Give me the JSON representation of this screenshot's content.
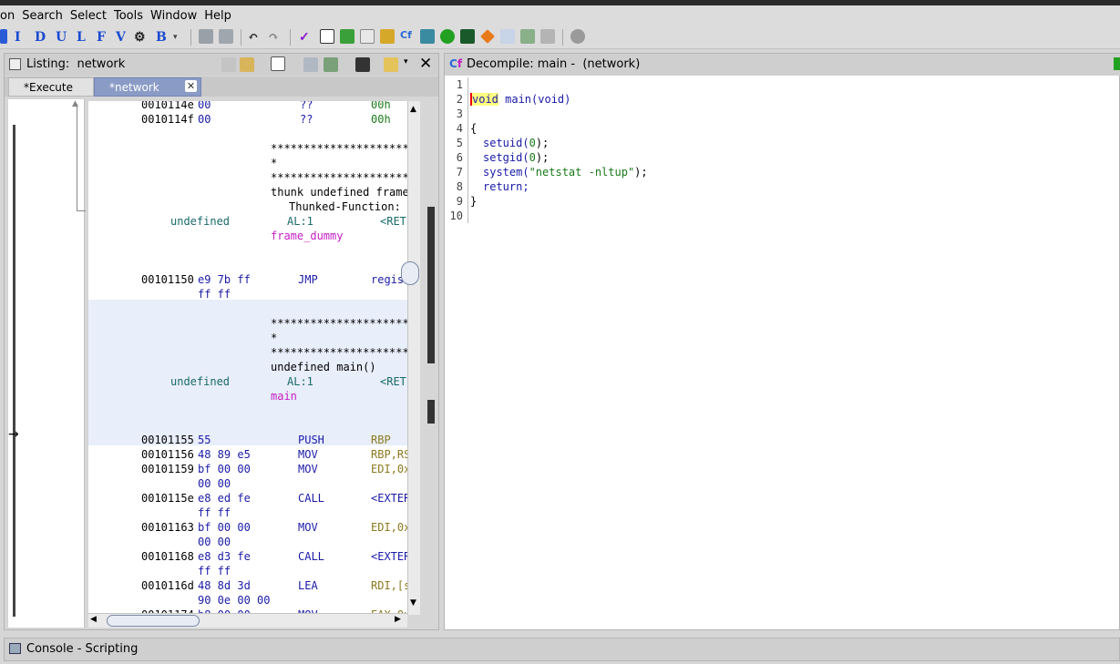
{
  "menu": [
    "on",
    "Search",
    "Select",
    "Tools",
    "Window",
    "Help"
  ],
  "toolbar": {
    "letters": [
      "I",
      "D",
      "U",
      "L",
      "F",
      "V",
      "B"
    ]
  },
  "listing": {
    "title": "Listing:  network",
    "tabs": [
      {
        "label": "*Execute"
      },
      {
        "label": "*network"
      }
    ],
    "rows": [
      {
        "addr": "0010114e",
        "bytes": "00",
        "mn": "??",
        "op": "00h"
      },
      {
        "addr": "0010114f",
        "bytes": "00",
        "mn": "??",
        "op": "00h"
      },
      {
        "addr": "00101150",
        "bytes": "e9 7b ff",
        "bytes2": "ff ff",
        "mn": "JMP",
        "op": "regist"
      },
      {
        "addr": "00101155",
        "bytes": "55",
        "mn": "PUSH",
        "op": "RBP"
      },
      {
        "addr": "00101156",
        "bytes": "48 89 e5",
        "mn": "MOV",
        "op": "RBP,RS"
      },
      {
        "addr": "00101159",
        "bytes": "bf 00 00",
        "bytes2": "00 00",
        "mn": "MOV",
        "op": "EDI,0x"
      },
      {
        "addr": "0010115e",
        "bytes": "e8 ed fe",
        "bytes2": "ff ff",
        "mn": "CALL",
        "op": "<EXTER"
      },
      {
        "addr": "00101163",
        "bytes": "bf 00 00",
        "bytes2": "00 00",
        "mn": "MOV",
        "op": "EDI,0x"
      },
      {
        "addr": "00101168",
        "bytes": "e8 d3 fe",
        "bytes2": "ff ff",
        "mn": "CALL",
        "op": "<EXTER"
      },
      {
        "addr": "0010116d",
        "bytes": "48 8d 3d",
        "bytes2": "90 0e 00 00",
        "mn": "LEA",
        "op": "RDI,[s"
      },
      {
        "addr": "00101174",
        "bytes": "b8 00 00",
        "mn": "MOV",
        "op": "EAX,0x"
      }
    ],
    "stars": "**********************",
    "star1": "*",
    "thunk_sig": "thunk undefined frame_",
    "thunked": "Thunked-Function:",
    "undefined": "undefined",
    "al1": "AL:1",
    "ret": "<RET",
    "frame_dummy": "frame_dummy",
    "main_sig": "undefined main()",
    "main_label": "main"
  },
  "decompile": {
    "title": "Decompile: main -  (network)",
    "lines": [
      "1",
      "2",
      "3",
      "4",
      "5",
      "6",
      "7",
      "8",
      "9",
      "10"
    ],
    "code": {
      "l2_kw": "void",
      "l2_rest": " main(void)",
      "l4": "{",
      "l5_fn": "setuid(",
      "l5_num": "0",
      "l5_end": ");",
      "l6_fn": "setgid(",
      "l6_num": "0",
      "l6_end": ");",
      "l7_fn": "system(",
      "l7_str": "\"netstat -nltup\"",
      "l7_end": ");",
      "l8": "return;",
      "l9": "}"
    }
  },
  "console": {
    "title": "Console - Scripting"
  }
}
